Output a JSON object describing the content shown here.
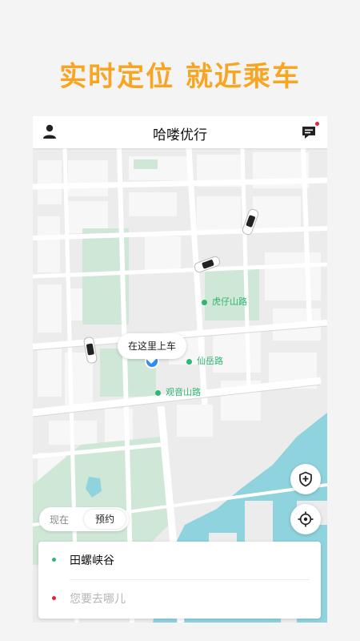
{
  "promo": {
    "text": "实时定位  就近乘车",
    "color": "#f6a623"
  },
  "appbar": {
    "title": "哈喽优行",
    "left_icon": "user-icon",
    "right_icon": "message-icon",
    "unread_badge_color": "#e0253c"
  },
  "map": {
    "pickup_callout": "在这里上车",
    "pois": [
      {
        "name": "虎仔山路"
      },
      {
        "name": "仙岳路"
      },
      {
        "name": "观音山路"
      }
    ],
    "colors": {
      "land": "#ececec",
      "block": "#f7f7f7",
      "road": "#ffffff",
      "park": "#cfe7d6",
      "water": "#8fd3df",
      "pin": "#2fb673",
      "location": "#2f8ef0"
    },
    "buttons": [
      "shield-plus-icon",
      "locate-crosshair-icon"
    ]
  },
  "time_toggle": {
    "now_label": "现在",
    "schedule_label": "预约"
  },
  "trip": {
    "pickup": {
      "value": "田螺峡谷",
      "dot_color": "#2fb673"
    },
    "destination": {
      "placeholder": "您要去哪儿",
      "dot_color": "#e0253c"
    }
  }
}
